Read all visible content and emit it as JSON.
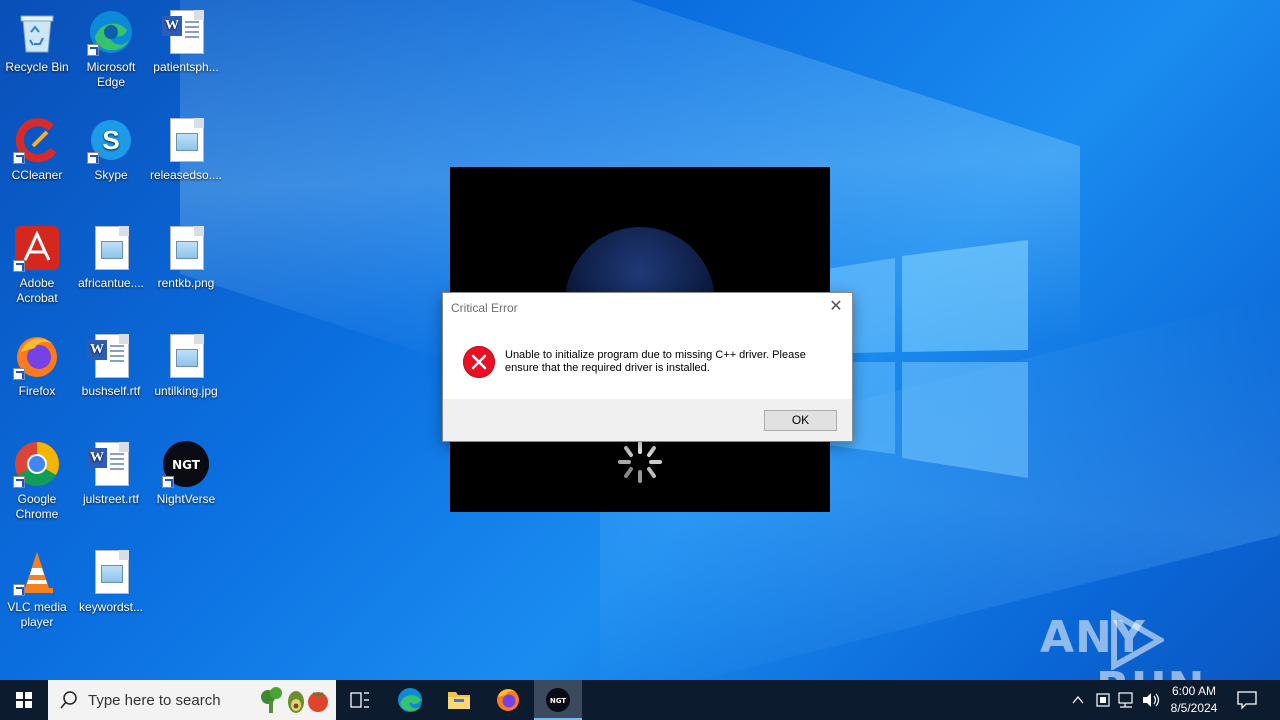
{
  "desktop": {
    "icons": [
      {
        "label": "Recycle Bin"
      },
      {
        "label": "Microsoft Edge"
      },
      {
        "label": "patientsph..."
      },
      {
        "label": "CCleaner"
      },
      {
        "label": "Skype"
      },
      {
        "label": "releasedso...."
      },
      {
        "label": "Adobe Acrobat"
      },
      {
        "label": "africantue...."
      },
      {
        "label": "rentkb.png"
      },
      {
        "label": "Firefox"
      },
      {
        "label": "bushself.rtf"
      },
      {
        "label": "untilking.jpg"
      },
      {
        "label": "Google Chrome"
      },
      {
        "label": "julstreet.rtf"
      },
      {
        "label": "NightVerse"
      },
      {
        "label": "VLC media player"
      },
      {
        "label": "keywordst..."
      }
    ]
  },
  "dialog": {
    "title": "Critical Error",
    "message": "Unable to initialize program due to missing C++ driver. Please ensure that the required driver is installed.",
    "ok_label": "OK",
    "icon": "error-icon"
  },
  "taskbar": {
    "search_placeholder": "Type here to search",
    "time": "6:00 AM",
    "date": "8/5/2024",
    "apps": [
      "task-view",
      "microsoft-edge",
      "file-explorer",
      "firefox",
      "nightverse"
    ]
  },
  "watermark": {
    "text": "ANY",
    "text2": "RUN"
  },
  "nightverse_badge": "NGT",
  "colors": {
    "accent": "#0078d7",
    "error": "#e81123",
    "taskbar": "#0d1b2e"
  }
}
